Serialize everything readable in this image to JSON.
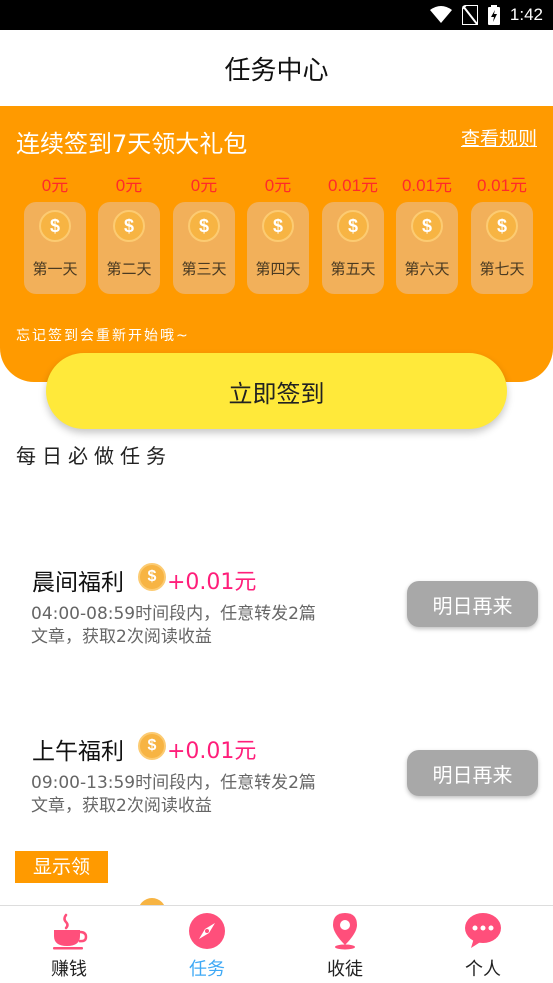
{
  "status_bar": {
    "time": "1:42"
  },
  "header": {
    "title": "任务中心"
  },
  "sign_panel": {
    "title": "连续签到7天领大礼包",
    "rules_link": "查看规则",
    "note": "忘记签到会重新开始哦~",
    "days": [
      {
        "amount": "0元",
        "label": "第一天"
      },
      {
        "amount": "0元",
        "label": "第二天"
      },
      {
        "amount": "0元",
        "label": "第三天"
      },
      {
        "amount": "0元",
        "label": "第四天"
      },
      {
        "amount": "0.01元",
        "label": "第五天"
      },
      {
        "amount": "0.01元",
        "label": "第六天"
      },
      {
        "amount": "0.01元",
        "label": "第七天"
      }
    ],
    "coin_symbol": "$"
  },
  "signin_button": "立即签到",
  "daily_section": {
    "title": "每日必做任务"
  },
  "tasks": [
    {
      "name": "晨间福利",
      "reward": "+0.01元",
      "desc": "04:00-08:59时间段内，任意转发2篇文章，获取2次阅读收益",
      "button": "明日再来"
    },
    {
      "name": "上午福利",
      "reward": "+0.01元",
      "desc": "09:00-13:59时间段内，任意转发2篇文章，获取2次阅读收益",
      "button": "明日再来"
    }
  ],
  "show_tag": "显示领",
  "bottom_nav": [
    {
      "label": "赚钱",
      "icon": "tea-cup-icon",
      "active": false
    },
    {
      "label": "任务",
      "icon": "compass-icon",
      "active": true
    },
    {
      "label": "收徒",
      "icon": "location-pin-icon",
      "active": false
    },
    {
      "label": "个人",
      "icon": "chat-bubble-icon",
      "active": false
    }
  ],
  "colors": {
    "accent_orange": "#ff9a00",
    "button_yellow": "#ffe93a",
    "reward_pink": "#ff1e7a",
    "amount_red": "#ff2a2a",
    "nav_active_blue": "#3fa9f5",
    "icon_pink": "#ff4f7b"
  }
}
